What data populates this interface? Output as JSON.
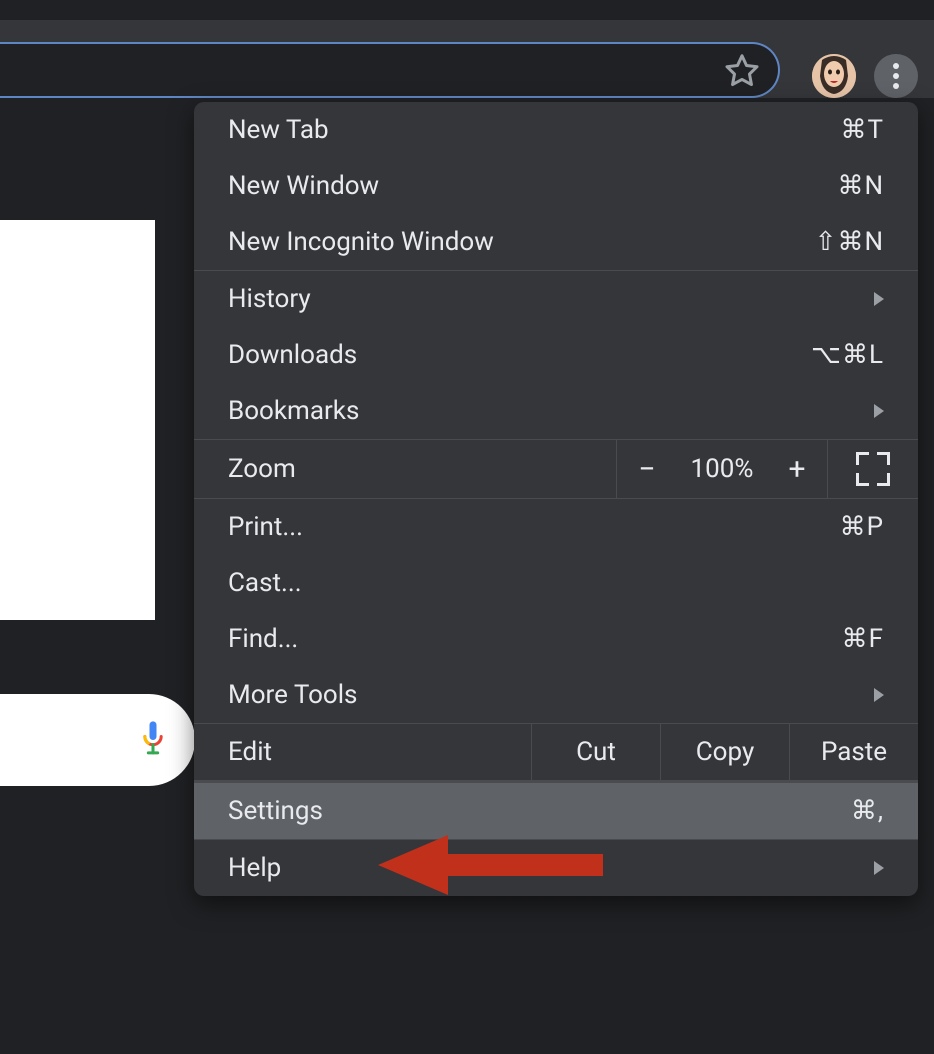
{
  "toolbar": {
    "star_icon": "star-icon",
    "avatar_icon": "avatar",
    "menu_icon": "more-vert-icon"
  },
  "menu": {
    "items": [
      {
        "label": "New Tab",
        "shortcut": "⌘T",
        "arrow": false
      },
      {
        "label": "New Window",
        "shortcut": "⌘N",
        "arrow": false
      },
      {
        "label": "New Incognito Window",
        "shortcut": "⇧⌘N",
        "arrow": false
      }
    ],
    "items2": [
      {
        "label": "History",
        "shortcut": "",
        "arrow": true
      },
      {
        "label": "Downloads",
        "shortcut": "⌥⌘L",
        "arrow": false
      },
      {
        "label": "Bookmarks",
        "shortcut": "",
        "arrow": true
      }
    ],
    "zoom": {
      "label": "Zoom",
      "minus": "−",
      "value": "100%",
      "plus": "+"
    },
    "items3": [
      {
        "label": "Print...",
        "shortcut": "⌘P",
        "arrow": false
      },
      {
        "label": "Cast...",
        "shortcut": "",
        "arrow": false
      },
      {
        "label": "Find...",
        "shortcut": "⌘F",
        "arrow": false
      },
      {
        "label": "More Tools",
        "shortcut": "",
        "arrow": true
      }
    ],
    "edit": {
      "label": "Edit",
      "cut": "Cut",
      "copy": "Copy",
      "paste": "Paste"
    },
    "settings": {
      "label": "Settings",
      "shortcut": "⌘,"
    },
    "help": {
      "label": "Help",
      "arrow": true
    }
  },
  "annotation": {
    "type": "arrow",
    "target": "settings"
  }
}
